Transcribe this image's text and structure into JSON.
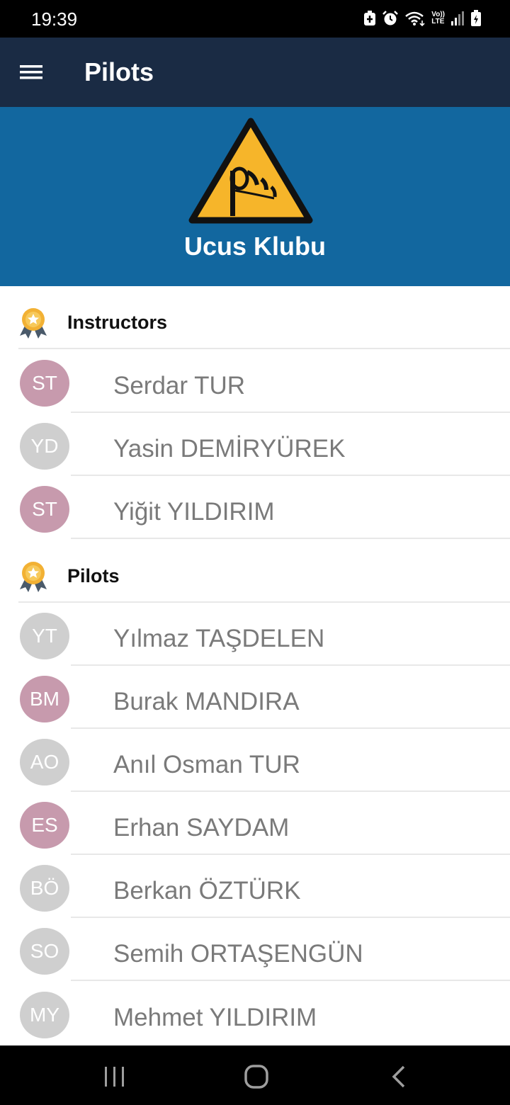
{
  "status_bar": {
    "time": "19:39",
    "icons": [
      "battery-saver-icon",
      "alarm-icon",
      "wifi-icon",
      "volte-icon",
      "signal-icon",
      "battery-icon"
    ],
    "volte_line1": "Vo))",
    "volte_line2": "LTE"
  },
  "app_bar": {
    "title": "Pilots",
    "menu_icon": "hamburger-menu-icon",
    "background": "#1a2b44"
  },
  "banner": {
    "club_name": "Ucus Klubu",
    "logo_icon": "windsock-warning-icon",
    "background": "#12679f"
  },
  "sections": {
    "instructors": {
      "label": "Instructors",
      "icon": "award-ribbon-icon"
    },
    "pilots": {
      "label": "Pilots",
      "icon": "award-ribbon-icon"
    }
  },
  "instructors": [
    {
      "initials": "ST",
      "name": "Serdar TUR",
      "color": "#c79aad"
    },
    {
      "initials": "YD",
      "name": "Yasin DEMİRYÜREK",
      "color": "#cfcfcf"
    },
    {
      "initials": "ST",
      "name": "Yiğit YILDIRIM",
      "color": "#c79aad"
    }
  ],
  "pilots": [
    {
      "initials": "YT",
      "name": "Yılmaz TAŞDELEN",
      "color": "#cfcfcf"
    },
    {
      "initials": "BM",
      "name": "Burak MANDIRA",
      "color": "#c79aad"
    },
    {
      "initials": "AO",
      "name": "Anıl Osman TUR",
      "color": "#cfcfcf"
    },
    {
      "initials": "ES",
      "name": "Erhan SAYDAM",
      "color": "#c79aad"
    },
    {
      "initials": "BÖ",
      "name": "Berkan ÖZTÜRK",
      "color": "#cfcfcf"
    },
    {
      "initials": "SO",
      "name": "Semih ORTAŞENGÜN",
      "color": "#cfcfcf"
    },
    {
      "initials": "MY",
      "name": "Mehmet YILDIRIM",
      "color": "#cfcfcf"
    }
  ],
  "nav_bar": {
    "icons": [
      "recent-apps-icon",
      "home-icon",
      "back-icon"
    ]
  }
}
